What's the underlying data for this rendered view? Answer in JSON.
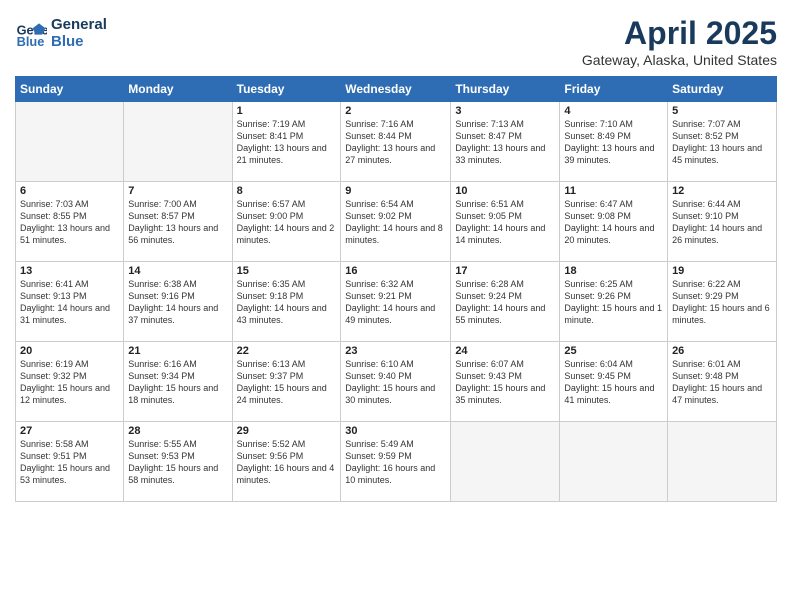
{
  "header": {
    "logo_line1": "General",
    "logo_line2": "Blue",
    "month": "April 2025",
    "location": "Gateway, Alaska, United States"
  },
  "weekdays": [
    "Sunday",
    "Monday",
    "Tuesday",
    "Wednesday",
    "Thursday",
    "Friday",
    "Saturday"
  ],
  "weeks": [
    [
      {
        "day": "",
        "empty": true
      },
      {
        "day": "",
        "empty": true
      },
      {
        "day": "1",
        "sunrise": "7:19 AM",
        "sunset": "8:41 PM",
        "daylight": "13 hours and 21 minutes."
      },
      {
        "day": "2",
        "sunrise": "7:16 AM",
        "sunset": "8:44 PM",
        "daylight": "13 hours and 27 minutes."
      },
      {
        "day": "3",
        "sunrise": "7:13 AM",
        "sunset": "8:47 PM",
        "daylight": "13 hours and 33 minutes."
      },
      {
        "day": "4",
        "sunrise": "7:10 AM",
        "sunset": "8:49 PM",
        "daylight": "13 hours and 39 minutes."
      },
      {
        "day": "5",
        "sunrise": "7:07 AM",
        "sunset": "8:52 PM",
        "daylight": "13 hours and 45 minutes."
      }
    ],
    [
      {
        "day": "6",
        "sunrise": "7:03 AM",
        "sunset": "8:55 PM",
        "daylight": "13 hours and 51 minutes."
      },
      {
        "day": "7",
        "sunrise": "7:00 AM",
        "sunset": "8:57 PM",
        "daylight": "13 hours and 56 minutes."
      },
      {
        "day": "8",
        "sunrise": "6:57 AM",
        "sunset": "9:00 PM",
        "daylight": "14 hours and 2 minutes."
      },
      {
        "day": "9",
        "sunrise": "6:54 AM",
        "sunset": "9:02 PM",
        "daylight": "14 hours and 8 minutes."
      },
      {
        "day": "10",
        "sunrise": "6:51 AM",
        "sunset": "9:05 PM",
        "daylight": "14 hours and 14 minutes."
      },
      {
        "day": "11",
        "sunrise": "6:47 AM",
        "sunset": "9:08 PM",
        "daylight": "14 hours and 20 minutes."
      },
      {
        "day": "12",
        "sunrise": "6:44 AM",
        "sunset": "9:10 PM",
        "daylight": "14 hours and 26 minutes."
      }
    ],
    [
      {
        "day": "13",
        "sunrise": "6:41 AM",
        "sunset": "9:13 PM",
        "daylight": "14 hours and 31 minutes."
      },
      {
        "day": "14",
        "sunrise": "6:38 AM",
        "sunset": "9:16 PM",
        "daylight": "14 hours and 37 minutes."
      },
      {
        "day": "15",
        "sunrise": "6:35 AM",
        "sunset": "9:18 PM",
        "daylight": "14 hours and 43 minutes."
      },
      {
        "day": "16",
        "sunrise": "6:32 AM",
        "sunset": "9:21 PM",
        "daylight": "14 hours and 49 minutes."
      },
      {
        "day": "17",
        "sunrise": "6:28 AM",
        "sunset": "9:24 PM",
        "daylight": "14 hours and 55 minutes."
      },
      {
        "day": "18",
        "sunrise": "6:25 AM",
        "sunset": "9:26 PM",
        "daylight": "15 hours and 1 minute."
      },
      {
        "day": "19",
        "sunrise": "6:22 AM",
        "sunset": "9:29 PM",
        "daylight": "15 hours and 6 minutes."
      }
    ],
    [
      {
        "day": "20",
        "sunrise": "6:19 AM",
        "sunset": "9:32 PM",
        "daylight": "15 hours and 12 minutes."
      },
      {
        "day": "21",
        "sunrise": "6:16 AM",
        "sunset": "9:34 PM",
        "daylight": "15 hours and 18 minutes."
      },
      {
        "day": "22",
        "sunrise": "6:13 AM",
        "sunset": "9:37 PM",
        "daylight": "15 hours and 24 minutes."
      },
      {
        "day": "23",
        "sunrise": "6:10 AM",
        "sunset": "9:40 PM",
        "daylight": "15 hours and 30 minutes."
      },
      {
        "day": "24",
        "sunrise": "6:07 AM",
        "sunset": "9:43 PM",
        "daylight": "15 hours and 35 minutes."
      },
      {
        "day": "25",
        "sunrise": "6:04 AM",
        "sunset": "9:45 PM",
        "daylight": "15 hours and 41 minutes."
      },
      {
        "day": "26",
        "sunrise": "6:01 AM",
        "sunset": "9:48 PM",
        "daylight": "15 hours and 47 minutes."
      }
    ],
    [
      {
        "day": "27",
        "sunrise": "5:58 AM",
        "sunset": "9:51 PM",
        "daylight": "15 hours and 53 minutes."
      },
      {
        "day": "28",
        "sunrise": "5:55 AM",
        "sunset": "9:53 PM",
        "daylight": "15 hours and 58 minutes."
      },
      {
        "day": "29",
        "sunrise": "5:52 AM",
        "sunset": "9:56 PM",
        "daylight": "16 hours and 4 minutes."
      },
      {
        "day": "30",
        "sunrise": "5:49 AM",
        "sunset": "9:59 PM",
        "daylight": "16 hours and 10 minutes."
      },
      {
        "day": "",
        "empty": true
      },
      {
        "day": "",
        "empty": true
      },
      {
        "day": "",
        "empty": true
      }
    ]
  ],
  "labels": {
    "sunrise_prefix": "Sunrise: ",
    "sunset_prefix": "Sunset: ",
    "daylight_prefix": "Daylight: "
  }
}
